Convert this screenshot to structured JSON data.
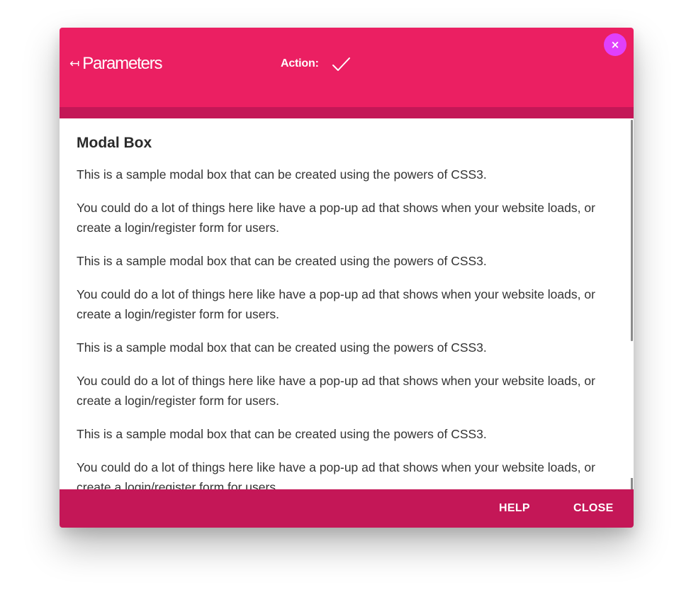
{
  "header": {
    "back_arrow": "↤",
    "back_label": "Parameters",
    "action_label": "Action:",
    "check_icon": "check-icon",
    "close_x": "×"
  },
  "content": {
    "title": "Modal Box",
    "paragraphs": [
      "This is a sample modal box that can be created using the powers of CSS3.",
      "You could do a lot of things here like have a pop-up ad that shows when your website loads, or create a login/register form for users.",
      "This is a sample modal box that can be created using the powers of CSS3.",
      "You could do a lot of things here like have a pop-up ad that shows when your website loads, or create a login/register form for users.",
      "This is a sample modal box that can be created using the powers of CSS3.",
      "You could do a lot of things here like have a pop-up ad that shows when your website loads, or create a login/register form for users.",
      "This is a sample modal box that can be created using the powers of CSS3.",
      "You could do a lot of things here like have a pop-up ad that shows when your website loads, or create a login/register form for users."
    ]
  },
  "footer": {
    "help_label": "HELP",
    "close_label": "CLOSE"
  },
  "colors": {
    "header": "#eb1f62",
    "header_strip": "#c41757",
    "footer": "#c41757",
    "close_badge": "#e040fb"
  }
}
